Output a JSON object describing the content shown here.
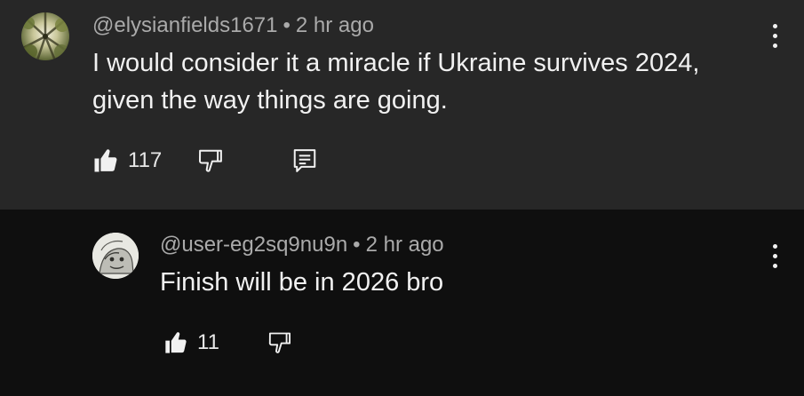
{
  "comments": [
    {
      "author": "@elysianfields1671",
      "time": "2 hr ago",
      "text": "I would consider it a miracle if Ukraine survives 2024, given the way things are going.",
      "likes": "117",
      "avatar_icon": "tree-canopy-avatar"
    },
    {
      "author": "@user-eg2sq9nu9n",
      "time": "2 hr ago",
      "text": "Finish will be in 2026 bro",
      "likes": "11",
      "avatar_icon": "sketch-face-avatar"
    }
  ],
  "separator": "•",
  "colors": {
    "top_bg": "#272727",
    "reply_bg": "#0f0f0f",
    "text": "#f1f1f1",
    "meta": "#aaaaaa"
  }
}
